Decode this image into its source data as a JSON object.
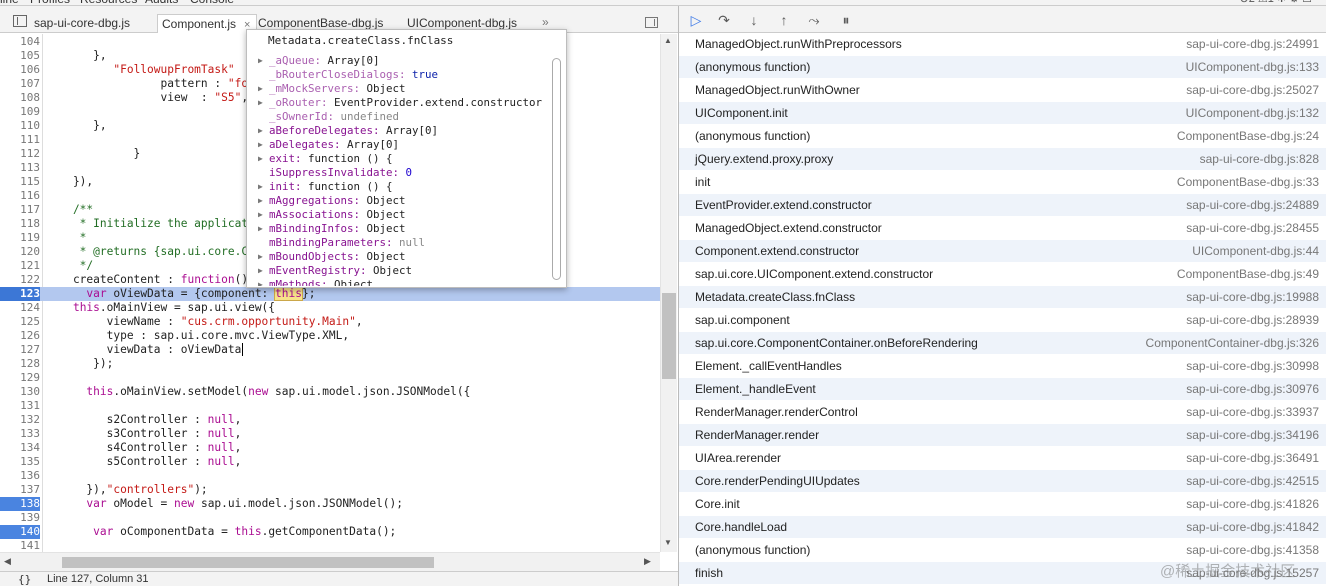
{
  "top_strip": {
    "panels": [
      "line",
      "Profiles",
      "Resources",
      "Audits",
      "Console"
    ],
    "status": "⊗2 ⚠1  ✲  ⚙  ☐"
  },
  "tabs": [
    {
      "label": "sap-ui-core-dbg.js",
      "active": false,
      "closable": false
    },
    {
      "label": "Component.js",
      "active": true,
      "closable": true
    },
    {
      "label": "ComponentBase-dbg.js",
      "active": false,
      "closable": false
    },
    {
      "label": "UIComponent-dbg.js",
      "active": false,
      "closable": false
    }
  ],
  "tabs_more": "»",
  "editor": {
    "lines": [
      {
        "n": "104",
        "code": ""
      },
      {
        "n": "105",
        "code": "       },"
      },
      {
        "n": "106",
        "code": "          \"FollowupFromTask\""
      },
      {
        "n": "107",
        "code": "                 pattern : \"fo"
      },
      {
        "n": "108",
        "code": "                 view  : \"S5\","
      },
      {
        "n": "109",
        "code": ""
      },
      {
        "n": "110",
        "code": "       },"
      },
      {
        "n": "111",
        "code": ""
      },
      {
        "n": "112",
        "code": "             }"
      },
      {
        "n": "113",
        "code": ""
      },
      {
        "n": "115",
        "code": "    }),"
      },
      {
        "n": "116",
        "code": ""
      },
      {
        "n": "117",
        "code": "    /**"
      },
      {
        "n": "118",
        "code": "     * Initialize the applicat"
      },
      {
        "n": "119",
        "code": "     *"
      },
      {
        "n": "120",
        "code": "     * @returns {sap.ui.core.C"
      },
      {
        "n": "121",
        "code": "     */"
      },
      {
        "n": "122",
        "code": "    createContent : function() {"
      },
      {
        "n": "123",
        "code": "      var oViewData = {component: this};"
      },
      {
        "n": "124",
        "code": "    this.oMainView = sap.ui.view({"
      },
      {
        "n": "125",
        "code": "         viewName : \"cus.crm.opportunity.Main\","
      },
      {
        "n": "126",
        "code": "         type : sap.ui.core.mvc.ViewType.XML,"
      },
      {
        "n": "127",
        "code": "         viewData : oViewData"
      },
      {
        "n": "128",
        "code": "       });"
      },
      {
        "n": "129",
        "code": ""
      },
      {
        "n": "130",
        "code": "      this.oMainView.setModel(new sap.ui.model.json.JSONModel({"
      },
      {
        "n": "131",
        "code": ""
      },
      {
        "n": "132",
        "code": "         s2Controller : null,"
      },
      {
        "n": "133",
        "code": "         s3Controller : null,"
      },
      {
        "n": "134",
        "code": "         s4Controller : null,"
      },
      {
        "n": "135",
        "code": "         s5Controller : null,"
      },
      {
        "n": "136",
        "code": ""
      },
      {
        "n": "137",
        "code": "      }),\"controllers\");"
      },
      {
        "n": "138",
        "code": "      var oModel = new sap.ui.model.json.JSONModel();"
      },
      {
        "n": "139",
        "code": ""
      },
      {
        "n": "140",
        "code": "       var oComponentData = this.getComponentData();"
      },
      {
        "n": "141",
        "code": ""
      }
    ],
    "status": "Line 127, Column 31",
    "status_icon": "{}"
  },
  "popover": {
    "title": "Metadata.createClass.fnClass",
    "props": [
      {
        "key": "_aQueue",
        "value": "Array[0]",
        "expandable": true,
        "vtype": "obj"
      },
      {
        "key": "_bRouterCloseDialogs",
        "value": "true",
        "expandable": false,
        "vtype": "bool"
      },
      {
        "key": "_mMockServers",
        "value": "Object",
        "expandable": true,
        "vtype": "obj"
      },
      {
        "key": "_oRouter",
        "value": "EventProvider.extend.constructor",
        "expandable": true,
        "vtype": "obj"
      },
      {
        "key": "_sOwnerId",
        "value": "undefined",
        "expandable": false,
        "vtype": "gray"
      },
      {
        "key": "aBeforeDelegates",
        "value": "Array[0]",
        "expandable": true,
        "vtype": "obj"
      },
      {
        "key": "aDelegates",
        "value": "Array[0]",
        "expandable": true,
        "vtype": "obj"
      },
      {
        "key": "exit",
        "value": "function () {",
        "expandable": true,
        "vtype": "obj"
      },
      {
        "key": "iSuppressInvalidate",
        "value": "0",
        "expandable": false,
        "vtype": "num"
      },
      {
        "key": "init",
        "value": "function () {",
        "expandable": true,
        "vtype": "obj"
      },
      {
        "key": "mAggregations",
        "value": "Object",
        "expandable": true,
        "vtype": "obj"
      },
      {
        "key": "mAssociations",
        "value": "Object",
        "expandable": true,
        "vtype": "obj"
      },
      {
        "key": "mBindingInfos",
        "value": "Object",
        "expandable": true,
        "vtype": "obj"
      },
      {
        "key": "mBindingParameters",
        "value": "null",
        "expandable": false,
        "vtype": "gray"
      },
      {
        "key": "mBoundObjects",
        "value": "Object",
        "expandable": true,
        "vtype": "obj"
      },
      {
        "key": "mEventRegistry",
        "value": "Object",
        "expandable": true,
        "vtype": "obj"
      },
      {
        "key": "mMethods",
        "value": "Object",
        "expandable": true,
        "vtype": "obj"
      }
    ]
  },
  "debugger_toolbar": {
    "buttons": [
      {
        "name": "resume-button",
        "glyph": "▷",
        "title": "Resume"
      },
      {
        "name": "step-over-button",
        "glyph": "↷",
        "title": "Step over"
      },
      {
        "name": "step-into-button",
        "glyph": "↓",
        "title": "Step into"
      },
      {
        "name": "step-out-button",
        "glyph": "↑",
        "title": "Step out"
      },
      {
        "name": "deactivate-breakpoints-button",
        "glyph": "⤳",
        "title": "Deactivate breakpoints"
      },
      {
        "name": "pause-on-exceptions-button",
        "glyph": "⏸",
        "title": "Pause on exceptions"
      }
    ]
  },
  "call_stack": [
    {
      "fn": "ManagedObject.runWithPreprocessors",
      "src": "sap-ui-core-dbg.js:24991"
    },
    {
      "fn": "(anonymous function)",
      "src": "UIComponent-dbg.js:133"
    },
    {
      "fn": "ManagedObject.runWithOwner",
      "src": "sap-ui-core-dbg.js:25027"
    },
    {
      "fn": "UIComponent.init",
      "src": "UIComponent-dbg.js:132"
    },
    {
      "fn": "(anonymous function)",
      "src": "ComponentBase-dbg.js:24"
    },
    {
      "fn": "jQuery.extend.proxy.proxy",
      "src": "sap-ui-core-dbg.js:828"
    },
    {
      "fn": "init",
      "src": "ComponentBase-dbg.js:33"
    },
    {
      "fn": "EventProvider.extend.constructor",
      "src": "sap-ui-core-dbg.js:24889"
    },
    {
      "fn": "ManagedObject.extend.constructor",
      "src": "sap-ui-core-dbg.js:28455"
    },
    {
      "fn": "Component.extend.constructor",
      "src": "UIComponent-dbg.js:44"
    },
    {
      "fn": "sap.ui.core.UIComponent.extend.constructor",
      "src": "ComponentBase-dbg.js:49"
    },
    {
      "fn": "Metadata.createClass.fnClass",
      "src": "sap-ui-core-dbg.js:19988"
    },
    {
      "fn": "sap.ui.component",
      "src": "sap-ui-core-dbg.js:28939"
    },
    {
      "fn": "sap.ui.core.ComponentContainer.onBeforeRendering",
      "src": "ComponentContainer-dbg.js:326"
    },
    {
      "fn": "Element._callEventHandles",
      "src": "sap-ui-core-dbg.js:30998"
    },
    {
      "fn": "Element._handleEvent",
      "src": "sap-ui-core-dbg.js:30976"
    },
    {
      "fn": "RenderManager.renderControl",
      "src": "sap-ui-core-dbg.js:33937"
    },
    {
      "fn": "RenderManager.render",
      "src": "sap-ui-core-dbg.js:34196"
    },
    {
      "fn": "UIArea.rerender",
      "src": "sap-ui-core-dbg.js:36491"
    },
    {
      "fn": "Core.renderPendingUIUpdates",
      "src": "sap-ui-core-dbg.js:42515"
    },
    {
      "fn": "Core.init",
      "src": "sap-ui-core-dbg.js:41826"
    },
    {
      "fn": "Core.handleLoad",
      "src": "sap-ui-core-dbg.js:41842"
    },
    {
      "fn": "(anonymous function)",
      "src": "sap-ui-core-dbg.js:41358"
    },
    {
      "fn": "finish",
      "src": "sap-ui-core-dbg.js:15257"
    }
  ],
  "watermark": "@稀土掘金技术社区",
  "colors": {
    "exec_line": "#b3c8ef",
    "breakpoint": "#3c77d6",
    "stack_alt_row": "#eef3fa"
  }
}
